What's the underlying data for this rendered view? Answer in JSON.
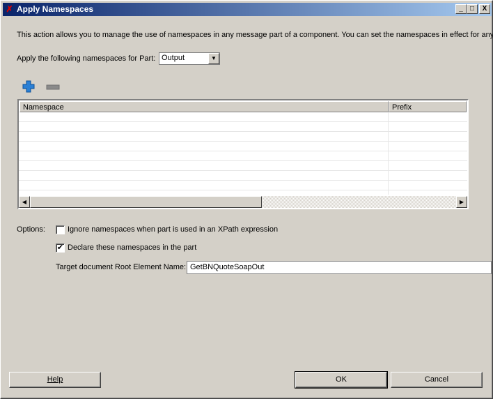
{
  "window": {
    "title": "Apply Namespaces",
    "controls": {
      "minimize": "_",
      "maximize": "□",
      "close": "X"
    }
  },
  "description": "This action allows you to manage the use of namespaces in any message part of a component. You can set the namespaces in effect for any r",
  "part": {
    "label": "Apply the following namespaces for Part:",
    "value": "Output"
  },
  "table": {
    "columns": [
      "Namespace",
      "Prefix"
    ],
    "rows": []
  },
  "options": {
    "label": "Options:",
    "ignore": {
      "label": "Ignore namespaces when part is used in an XPath expression",
      "checked": false
    },
    "declare": {
      "label": "Declare these namespaces in the part",
      "checked": true
    },
    "root": {
      "label": "Target document Root Element Name:",
      "value": "GetBNQuoteSoapOut"
    }
  },
  "buttons": {
    "help": "Help",
    "ok": "OK",
    "cancel": "Cancel"
  },
  "colors": {
    "accent": "#0a246a",
    "face": "#d4d0c8"
  }
}
